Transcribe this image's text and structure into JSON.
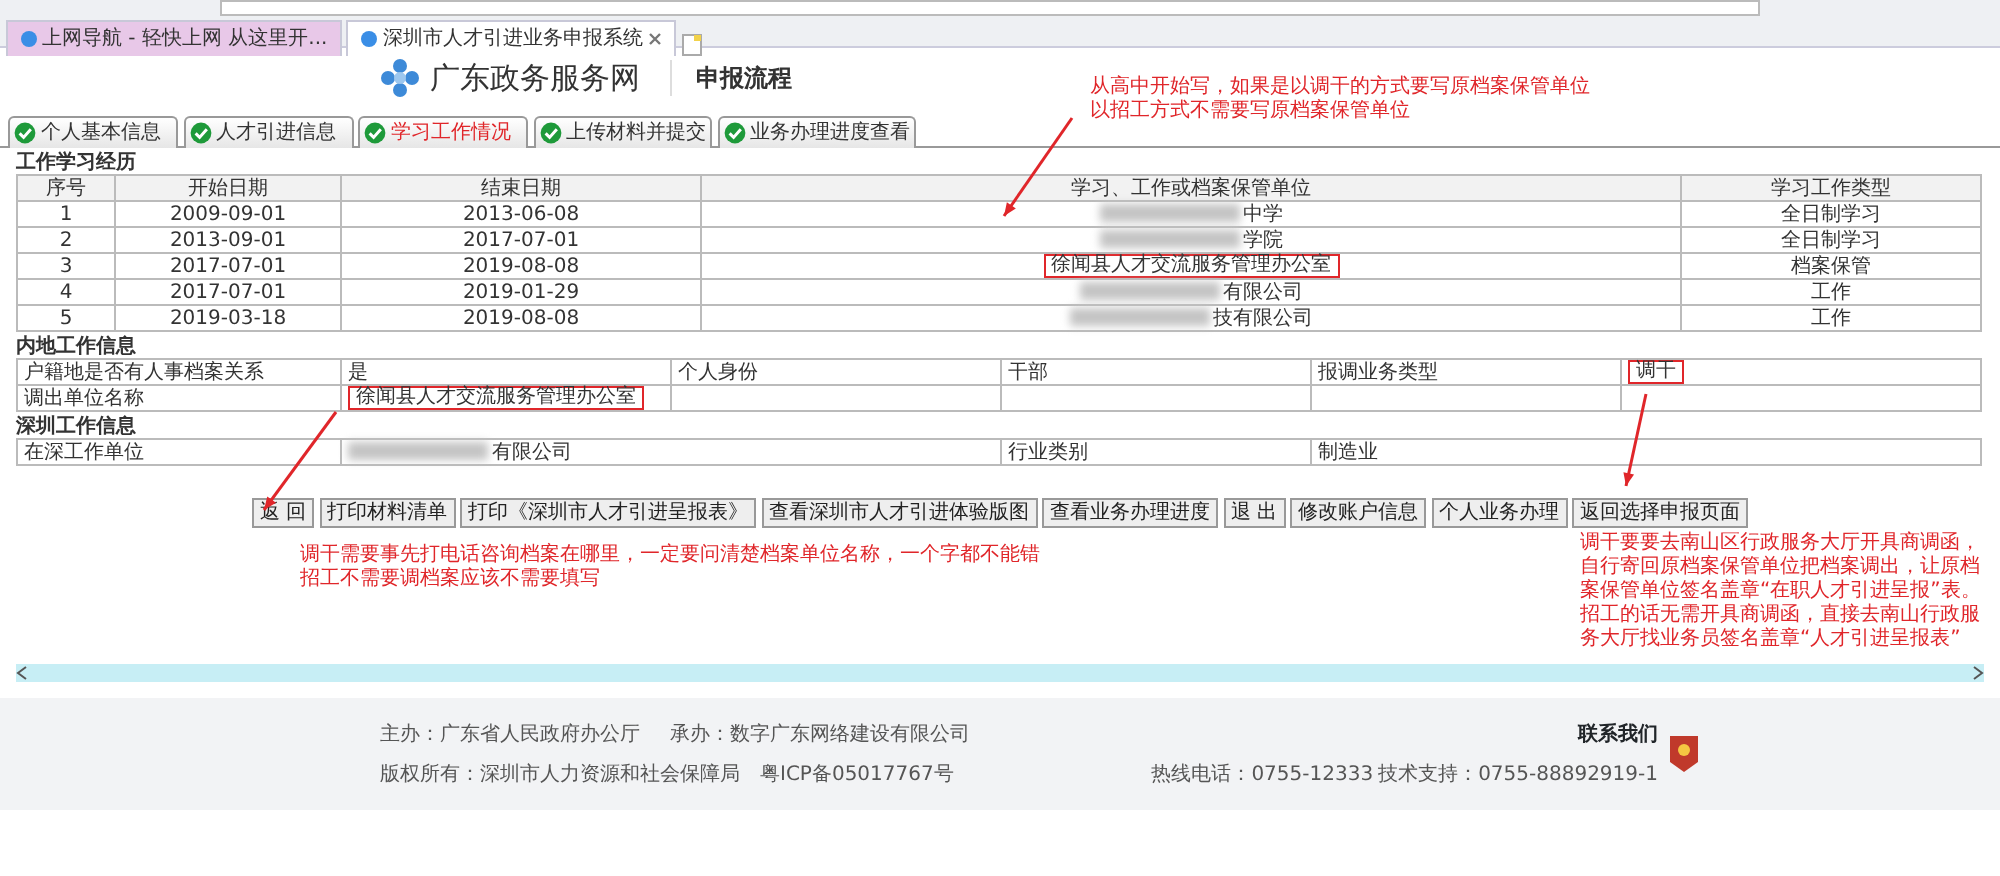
{
  "browser_tabs": [
    {
      "label": "上网导航 - 轻快上网 从这里开...",
      "selected": false
    },
    {
      "label": "深圳市人才引进业务申报系统",
      "selected": true
    }
  ],
  "header": {
    "site_name": "广东政务服务网",
    "page_title": "申报流程"
  },
  "steps": [
    {
      "label": "个人基本信息",
      "done": true,
      "selected": false
    },
    {
      "label": "人才引进信息",
      "done": true,
      "selected": false
    },
    {
      "label": "学习工作情况",
      "done": true,
      "selected": true
    },
    {
      "label": "上传材料并提交",
      "done": true,
      "selected": false
    },
    {
      "label": "业务办理进度查看",
      "done": true,
      "selected": false
    }
  ],
  "study_work": {
    "title": "工作学习经历",
    "columns": [
      "序号",
      "开始日期",
      "结束日期",
      "学习、工作或档案保管单位",
      "学习工作类型"
    ],
    "rows": [
      {
        "cells": [
          "1",
          "2009-09-01",
          "2013-06-08",
          "中学",
          "全日制学习"
        ],
        "redacted": true,
        "highlighted": false
      },
      {
        "cells": [
          "2",
          "2013-09-01",
          "2017-07-01",
          "学院",
          "全日制学习"
        ],
        "redacted": true,
        "highlighted": false
      },
      {
        "cells": [
          "3",
          "2017-07-01",
          "2019-08-08",
          "徐闻县人才交流服务管理办公室",
          "档案保管"
        ],
        "redacted": false,
        "highlighted": true
      },
      {
        "cells": [
          "4",
          "2017-07-01",
          "2019-01-29",
          "有限公司",
          "工作"
        ],
        "redacted": true,
        "highlighted": false
      },
      {
        "cells": [
          "5",
          "2019-03-18",
          "2019-08-08",
          "技有限公司",
          "工作"
        ],
        "redacted": true,
        "highlighted": false
      }
    ]
  },
  "mainland": {
    "title": "内地工作信息",
    "rows": [
      [
        {
          "text": "户籍地是否有人事档案关系",
          "highlighted": false
        },
        {
          "text": "是",
          "highlighted": false
        },
        {
          "text": "个人身份",
          "highlighted": false
        },
        {
          "text": "干部",
          "highlighted": false
        },
        {
          "text": "报调业务类型",
          "highlighted": false
        },
        {
          "text": "调干",
          "highlighted": true
        }
      ],
      [
        {
          "text": "调出单位名称",
          "highlighted": false
        },
        {
          "text": "徐闻县人才交流服务管理办公室",
          "highlighted": true
        }
      ]
    ]
  },
  "shenzhen": {
    "title": "深圳工作信息",
    "rows": [
      [
        {
          "text": "在深工作单位",
          "redacted": false
        },
        {
          "text": "有限公司",
          "redacted": true
        },
        {
          "text": "行业类别",
          "redacted": false
        },
        {
          "text": "制造业",
          "redacted": false
        }
      ]
    ]
  },
  "buttons": [
    "返 回",
    "打印材料清单",
    "打印《深圳市人才引进呈报表》",
    "查看深圳市人才引进体验版图",
    "查看业务办理进度",
    "退 出",
    "修改账户信息",
    "个人业务办理",
    "返回选择申报页面"
  ],
  "notes": [
    {
      "lines": [
        "从高中开始写，如果是以调干的方式要写原档案保管单位",
        "以招工方式不需要写原档案保管单位"
      ]
    },
    {
      "lines": [
        "调干需要事先打电话咨询档案在哪里，一定要问清楚档案单位名称，一个字都不能错",
        "招工不需要调档案应该不需要填写"
      ]
    },
    {
      "lines": [
        "调干要要去南山区行政服务大厅开具商调函，自行寄回原档案保管单位把档案调出，让原档案保管单位签名盖章“在职人才引进呈报”表。",
        "招工的话无需开具商调函，直接去南山行政服务大厅找业务员签名盖章“人才引进呈报表”"
      ]
    }
  ],
  "footer": {
    "sponsor": "主办：广东省人民政府办公厅",
    "organizer": "承办：数字广东网络建设有限公司",
    "copyright": "版权所有：深圳市人力资源和社会保障局",
    "icp": "粤ICP备05017767号",
    "contact_title": "联系我们",
    "hotline": "热线电话：0755-12333",
    "support": "技术支持：0755-88892919-1"
  }
}
